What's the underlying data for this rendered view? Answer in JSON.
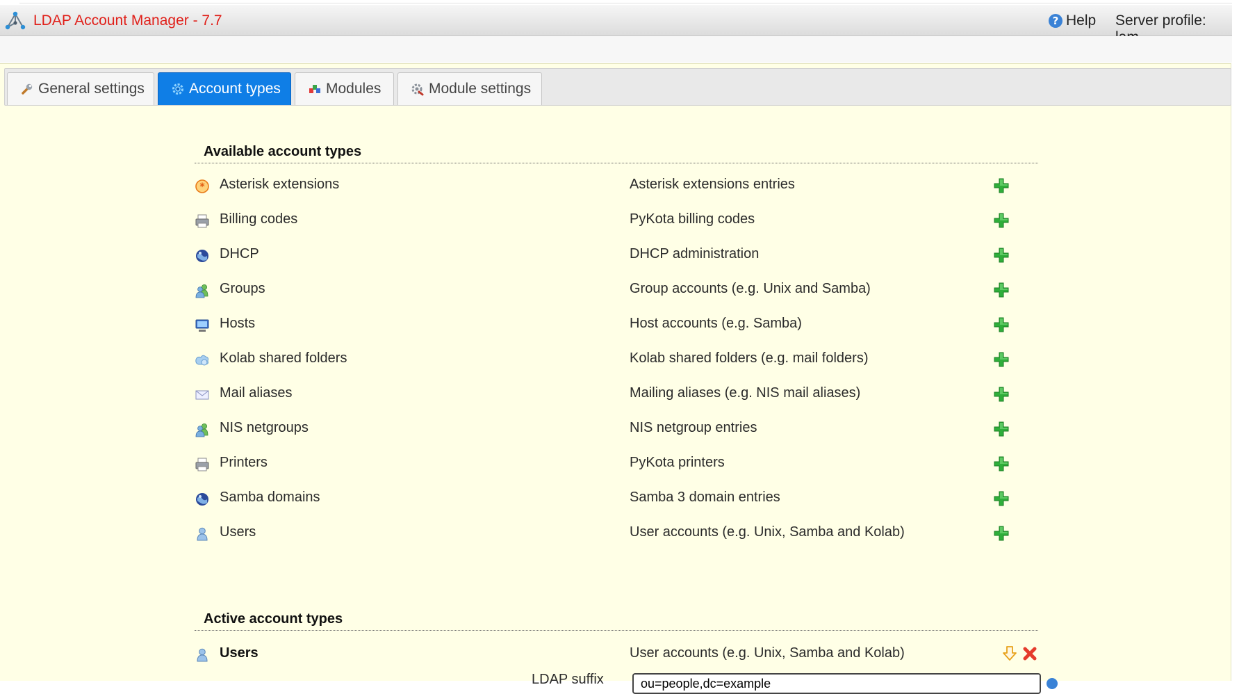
{
  "header": {
    "app_title": "LDAP Account Manager - 7.7",
    "help_label": "Help",
    "profile_label": "Server profile: lam"
  },
  "tabs": [
    {
      "label": "General settings",
      "icon": "wrench-icon",
      "active": false
    },
    {
      "label": "Account types",
      "icon": "gear-icon",
      "active": true
    },
    {
      "label": "Modules",
      "icon": "modules-icon",
      "active": false
    },
    {
      "label": "Module settings",
      "icon": "module-settings-icon",
      "active": false
    }
  ],
  "available": {
    "title": "Available account types",
    "items": [
      {
        "name": "Asterisk extensions",
        "description": "Asterisk extensions entries",
        "icon": "asterisk-icon"
      },
      {
        "name": "Billing codes",
        "description": "PyKota billing codes",
        "icon": "printer-icon"
      },
      {
        "name": "DHCP",
        "description": "DHCP administration",
        "icon": "globe-icon"
      },
      {
        "name": "Groups",
        "description": "Group accounts (e.g. Unix and Samba)",
        "icon": "group-icon"
      },
      {
        "name": "Hosts",
        "description": "Host accounts (e.g. Samba)",
        "icon": "computer-icon"
      },
      {
        "name": "Kolab shared folders",
        "description": "Kolab shared folders (e.g. mail folders)",
        "icon": "shared-folder-icon"
      },
      {
        "name": "Mail aliases",
        "description": "Mailing aliases (e.g. NIS mail aliases)",
        "icon": "mail-icon"
      },
      {
        "name": "NIS netgroups",
        "description": "NIS netgroup entries",
        "icon": "group-icon"
      },
      {
        "name": "Printers",
        "description": "PyKota printers",
        "icon": "printer-icon"
      },
      {
        "name": "Samba domains",
        "description": "Samba 3 domain entries",
        "icon": "globe-icon"
      },
      {
        "name": "Users",
        "description": "User accounts (e.g. Unix, Samba and Kolab)",
        "icon": "user-icon"
      }
    ]
  },
  "active": {
    "title": "Active account types",
    "items": [
      {
        "name": "Users",
        "description": "User accounts (e.g. Unix, Samba and Kolab)",
        "icon": "user-icon"
      }
    ],
    "suffix_label": "LDAP suffix",
    "suffix_value": "ou=people,dc=example"
  },
  "colors": {
    "accent": "#0f7ee6",
    "title_red": "#e0201a",
    "content_bg": "#ffffe6",
    "add_green": "#2fae3a",
    "remove_red": "#e53b2c"
  }
}
